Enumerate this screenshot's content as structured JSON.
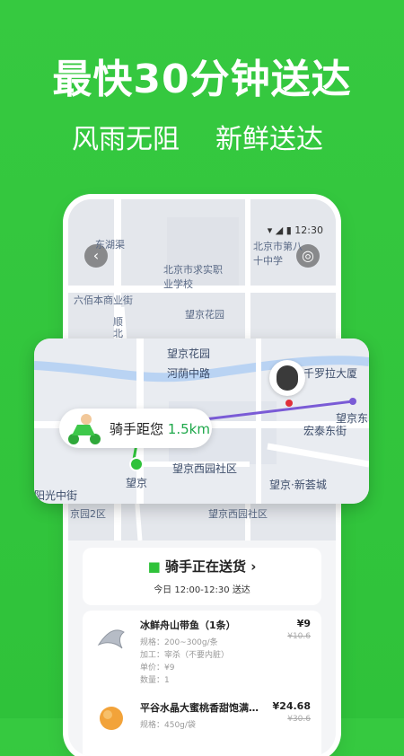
{
  "banner": {
    "headline": "最快30分钟送达",
    "sub_left": "风雨无阻",
    "sub_right": "新鲜送达"
  },
  "phone": {
    "status_time": "12:30",
    "map_labels": [
      "东湖渠",
      "北京市求实职业学校",
      "北京市第八十中学",
      "六佰本商业街",
      "望京花园",
      "顺北大街"
    ],
    "callout": {
      "labels": [
        "望京花园",
        "河荫中路",
        "千罗拉大厦",
        "望京东",
        "宏泰东街",
        "望京西园社区",
        "望京·新荟城",
        "阳光中街",
        "望京"
      ],
      "rider_text": "骑手距您",
      "rider_distance": "1.5km"
    },
    "lower_map_labels": [
      "京园2区",
      "望京西园社区"
    ],
    "delivery": {
      "title": "骑手正在送货",
      "time_prefix": "今日",
      "time_range": "12:00-12:30",
      "time_suffix": "送达"
    },
    "items": [
      {
        "name": "冰鲜舟山带鱼（1条）",
        "price": "¥9",
        "old_price": "¥10.6",
        "specs": [
          "规格：200~300g/条",
          "加工：宰杀（不要内脏）",
          "单价：¥9",
          "数量：1"
        ]
      },
      {
        "name": "平谷水晶大蜜桃香甜饱满…",
        "price": "¥24.68",
        "old_price": "¥30.6",
        "specs": [
          "规格：450g/袋"
        ]
      }
    ]
  },
  "colors": {
    "brand_green": "#2fc23a",
    "accent_green": "#1ea84a",
    "route_purple": "#7a5bd6"
  }
}
